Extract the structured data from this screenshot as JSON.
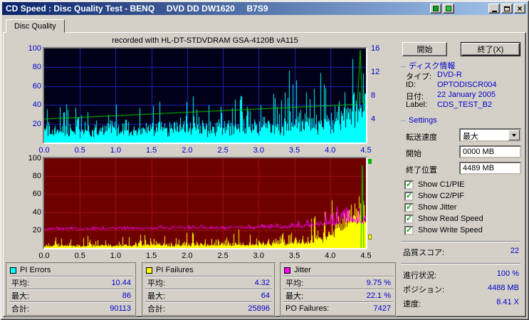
{
  "window": {
    "title": "CD Speed : Disc Quality Test - BENQ     DVD DD DW1620     B7S9"
  },
  "tabs": {
    "disc_quality": "Disc Quality"
  },
  "charts": {
    "recorded_note": "recorded with HL-DT-STDVDRAM GSA-4120B vA115"
  },
  "chart_data": [
    {
      "type": "area",
      "name": "pi-errors-and-speed",
      "x_range": [
        0,
        4.5
      ],
      "x_ticks": [
        "0.0",
        "0.5",
        "1.0",
        "1.5",
        "2.0",
        "2.5",
        "3.0",
        "3.5",
        "4.0",
        "4.5"
      ],
      "y_left": {
        "range": [
          0,
          100
        ],
        "ticks": [
          100,
          80,
          60,
          40,
          20
        ]
      },
      "y_right": {
        "range": [
          0,
          16
        ],
        "ticks": [
          16,
          12,
          8,
          4
        ]
      },
      "bg": "#000018",
      "grid": "#2323bb",
      "tick_color": "#0000cc",
      "series": [
        {
          "name": "PI Errors",
          "color": "#00ffff",
          "style": "spikes",
          "fill": 0.3,
          "seed": 12345,
          "envelope": [
            [
              0,
              14,
              40
            ],
            [
              0.5,
              15,
              45
            ],
            [
              1,
              15,
              42
            ],
            [
              1.5,
              16,
              46
            ],
            [
              2,
              17,
              52
            ],
            [
              2.5,
              18,
              56
            ],
            [
              3,
              20,
              62
            ],
            [
              3.4,
              22,
              70
            ],
            [
              3.7,
              24,
              80
            ],
            [
              4.0,
              28,
              90
            ],
            [
              4.2,
              34,
              100
            ],
            [
              4.35,
              44,
              100
            ],
            [
              4.5,
              50,
              100
            ]
          ]
        },
        {
          "name": "Speed",
          "color": "#00cc00",
          "style": "line",
          "axis": "right",
          "points": [
            [
              0,
              4.0
            ],
            [
              4.38,
              6.5
            ],
            [
              4.42,
              15.7
            ],
            [
              4.45,
              6.8
            ],
            [
              4.5,
              6.8
            ]
          ]
        }
      ]
    },
    {
      "type": "area",
      "name": "pi-failures-and-jitter",
      "x_range": [
        0,
        4.5
      ],
      "x_ticks": [
        "0.0",
        "0.5",
        "1.0",
        "1.5",
        "2.0",
        "2.5",
        "3.0",
        "3.5",
        "4.0",
        "4.5"
      ],
      "y_left": {
        "range": [
          0,
          100
        ],
        "ticks": [
          100,
          80,
          60,
          40,
          20
        ]
      },
      "bg": "#6e0000",
      "grid": "#a01010",
      "tick_color": "#000000",
      "series": [
        {
          "name": "PI Failures",
          "color": "#ffff00",
          "style": "spikes",
          "fill": 0.5,
          "seed": 777,
          "envelope": [
            [
              0,
              2,
              12
            ],
            [
              1,
              2.5,
              14
            ],
            [
              2,
              3,
              16
            ],
            [
              3,
              4,
              20
            ],
            [
              3.4,
              5,
              26
            ],
            [
              3.7,
              8,
              36
            ],
            [
              3.9,
              12,
              46
            ],
            [
              4.05,
              22,
              56
            ],
            [
              4.2,
              36,
              64
            ],
            [
              4.35,
              48,
              66
            ],
            [
              4.45,
              52,
              64
            ],
            [
              4.5,
              38,
              56
            ]
          ]
        },
        {
          "name": "End speed spike",
          "color": "#00cc00",
          "style": "line",
          "axis": "left",
          "points": [
            [
              4.43,
              0
            ],
            [
              4.45,
              92
            ],
            [
              4.47,
              0
            ]
          ]
        },
        {
          "name": "Jitter",
          "color": "#ff00ff",
          "style": "noisy-line",
          "seed": 555,
          "envelope": [
            [
              0,
              21,
              2
            ],
            [
              1,
              21.5,
              2
            ],
            [
              2,
              22,
              2.5
            ],
            [
              3,
              22.5,
              3
            ],
            [
              3.4,
              23,
              5
            ],
            [
              3.7,
              24,
              9
            ],
            [
              3.9,
              25,
              14
            ],
            [
              4.05,
              26,
              18
            ],
            [
              4.2,
              28,
              22
            ],
            [
              4.35,
              29,
              23
            ],
            [
              4.5,
              27,
              16
            ]
          ]
        }
      ]
    }
  ],
  "panel": {
    "start_button": "開始",
    "exit_button": "終了(X)",
    "disc_info": {
      "header": "ディスク情報",
      "rows": [
        {
          "label": "タイプ:",
          "value": "DVD-R"
        },
        {
          "label": "ID:",
          "value": "OPTODISCR004"
        },
        {
          "label": "日付:",
          "value": "22 January 2005"
        },
        {
          "label": "Label:",
          "value": "CDS_TEST_B2"
        }
      ]
    },
    "settings": {
      "header": "Settings",
      "transfer_speed_label": "転送速度",
      "transfer_speed_value": "最大",
      "start_label": "開始",
      "start_value": "0000 MB",
      "end_label": "終了位置",
      "end_value": "4489 MB",
      "checkboxes": [
        {
          "label": "Show C1/PIE",
          "checked": true
        },
        {
          "label": "Show C2/PIF",
          "checked": true
        },
        {
          "label": "Show Jitter",
          "checked": true
        },
        {
          "label": "Show Read Speed",
          "checked": true
        },
        {
          "label": "Show Write Speed",
          "checked": true
        }
      ]
    },
    "quality_score": {
      "label": "品質スコア:",
      "value": "22"
    },
    "progress": {
      "label": "進行状況:",
      "value": "100 %"
    },
    "position": {
      "label": "ポジション:",
      "value": "4488 MB"
    },
    "speed": {
      "label": "速度:",
      "value": "8.41 X"
    }
  },
  "stats": [
    {
      "title": "PI Errors",
      "color": "#00ffff",
      "rows": [
        {
          "label": "平均:",
          "value": "10.44"
        },
        {
          "label": "最大:",
          "value": "86"
        },
        {
          "label": "合計:",
          "value": "90113"
        }
      ]
    },
    {
      "title": "PI Failures",
      "color": "#ffff00",
      "rows": [
        {
          "label": "平均:",
          "value": "4.32"
        },
        {
          "label": "最大:",
          "value": "64"
        },
        {
          "label": "合計:",
          "value": "25896"
        }
      ]
    },
    {
      "title": "Jitter",
      "color": "#ff00ff",
      "rows": [
        {
          "label": "平均:",
          "value": "9.75 %"
        },
        {
          "label": "最大:",
          "value": "22.1 %"
        },
        {
          "label": "PO Failures:",
          "value": "7427"
        }
      ]
    }
  ]
}
